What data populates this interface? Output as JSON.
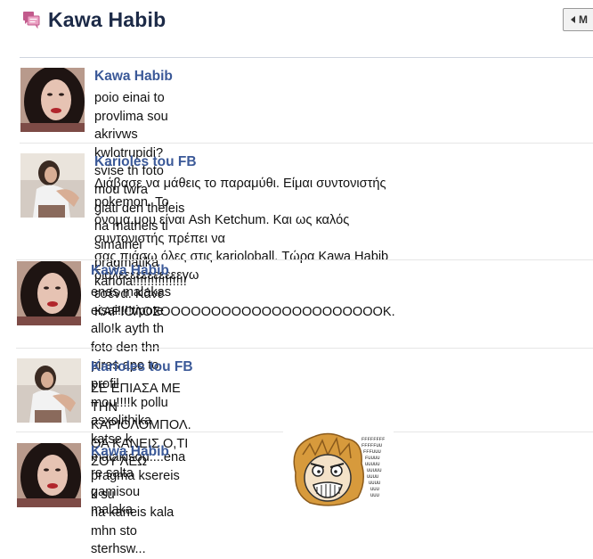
{
  "header": {
    "title": "Kawa Habib",
    "older_button_label": "M",
    "icon": "messages-icon"
  },
  "messages": [
    {
      "author": "Kawa Habib",
      "avatar": "dark-haired-woman-red-lips",
      "text": "poio einai to provlima sou akrivws kwlotrupidi?svise th foto mou twra\ngiati den theleis na matheis ti simainei pragmatika kariola!!!!!!!!!!!!!!!"
    },
    {
      "author": "Karioles tou FB",
      "avatar": "woman-posing-pale-room",
      "text": "Διάβασε να μάθεις το παραμύθι. Είμαι συντονιστής pokemon. Το\nόνομα μου είναι Ash Ketchum. Και ως καλός συντονιστής πρέπει να\nσας πιάσω όλες στις karioloball. Τώρα Kawa Habib διαλεεεεεεεεεεεγω\nεσένα. Κάνε ΚΑΡΙΟΛΟΣΟΟΟΟΟΟΟΟΟΟΟΟΟΟΟΟΟΟΟΟΟΟΚ."
    },
    {
      "author": "Kawa Habib",
      "avatar": "dark-haired-woman-red-lips",
      "text": "enas malakas eisai!!!!tipote allo!k ayth th foto den thn pires apo to profil\nmou!!!!k pollu asxolithika katse k malakisou....ena pragma ksereis k su\nna kaneis kala mhn sto sterhsw..."
    },
    {
      "author": "Karioles tou FB",
      "avatar": "woman-posing-pale-room",
      "text": "ΣΕ ΕΠΙΑΣΑ ΜΕ ΤΗΝ ΚΑΡΙΟΛΟΜΠΟΛ. ΘΑ ΚΑΝΕΙΣ Ο,ΤΙ ΣΟΥ ΛΕΩ"
    },
    {
      "author": "Kawa Habib",
      "avatar": "dark-haired-woman-red-lips",
      "text": "re salta gamisou malaka"
    }
  ],
  "meme": {
    "name": "rage-face-meme",
    "caption": "FFFFFFFUUUUUUUU"
  }
}
